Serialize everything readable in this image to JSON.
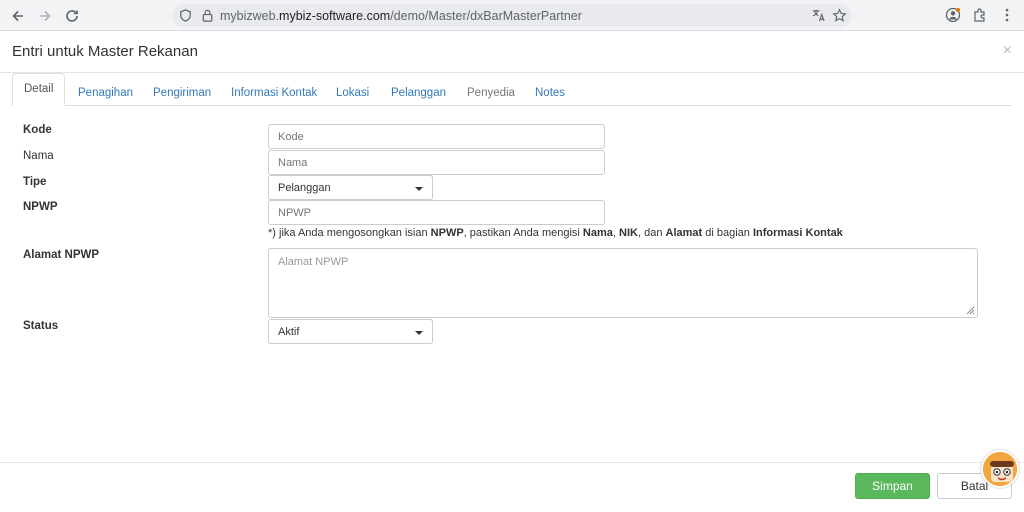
{
  "browser": {
    "url_prefix": "mybizweb.",
    "url_domain": "mybiz-software.com",
    "url_path": "/demo/Master/dxBarMasterPartner",
    "icons": [
      "back-icon",
      "forward-icon",
      "reload-icon",
      "site-info-icon",
      "lock-icon",
      "translate-icon",
      "bookmark-star-icon",
      "profile-icon",
      "extensions-icon",
      "menu-icon"
    ]
  },
  "modal": {
    "title": "Entri untuk Master Rekanan",
    "close": "×"
  },
  "tabs": [
    {
      "label": "Detail",
      "active": true
    },
    {
      "label": "Penagihan"
    },
    {
      "label": "Pengiriman"
    },
    {
      "label": "Informasi Kontak"
    },
    {
      "label": "Lokasi"
    },
    {
      "label": "Pelanggan"
    },
    {
      "label": "Penyedia"
    },
    {
      "label": "Notes"
    }
  ],
  "form": {
    "kode": {
      "label": "Kode",
      "placeholder": "Kode",
      "value": ""
    },
    "nama": {
      "label": "Nama",
      "placeholder": "Nama",
      "value": ""
    },
    "tipe": {
      "label": "Tipe",
      "value": "Pelanggan"
    },
    "npwp": {
      "label": "NPWP",
      "placeholder": "NPWP",
      "value": ""
    },
    "note": {
      "p1": "*) jika Anda mengosongkan isian ",
      "b1": "NPWP",
      "p2": ", pastikan Anda mengisi ",
      "b2": "Nama",
      "p3": ", ",
      "b3": "NIK",
      "p4": ", dan ",
      "b4": "Alamat",
      "p5": " di bagian ",
      "b5": "Informasi Kontak"
    },
    "alamat_npwp": {
      "label": "Alamat NPWP",
      "placeholder": "Alamat NPWP",
      "value": ""
    },
    "status": {
      "label": "Status",
      "value": "Aktif"
    }
  },
  "footer": {
    "save_label": "Simpan",
    "cancel_label": "Batal"
  },
  "colors": {
    "link": "#337ab7",
    "save_button": "#5cb85c"
  }
}
